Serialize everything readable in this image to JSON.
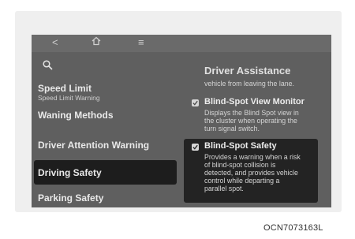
{
  "topbar": {
    "icons": [
      "back-chevron-icon",
      "home-icon",
      "menu-icon"
    ],
    "back_glyph": "<",
    "menu_glyph": "≡"
  },
  "left_panel": {
    "search_icon": "search-icon",
    "items": [
      {
        "title": "Speed Limit",
        "subtitle": "Speed Limit Warning"
      },
      {
        "title": "Waning Methods"
      },
      {
        "title": "Driver Attention Warning"
      },
      {
        "title": "Driving Safety",
        "selected": true
      },
      {
        "title": "Parking Safety"
      }
    ]
  },
  "right_panel": {
    "title": "Driver Assistance",
    "truncated_text": "vehicle from leaving the lane.",
    "options": [
      {
        "label": "Blind-Spot View Monitor",
        "checked": true,
        "desc_lines": [
          "Displays the Blind Spot view in",
          "the cluster when operating the",
          "turn signal switch."
        ]
      },
      {
        "label": "Blind-Spot Safety",
        "checked": true,
        "highlighted": true,
        "desc_lines": [
          "Provides a warning when a risk",
          "of blind-spot collision is",
          "detected, and provides vehicle",
          "control while departing a",
          "parallel spot."
        ]
      }
    ]
  },
  "figure_code": "OCN7073163L",
  "colors": {
    "screen_bg": "#5f5f5f",
    "selected_bg": "#1d1d1d",
    "highlight_bg": "#232323"
  }
}
